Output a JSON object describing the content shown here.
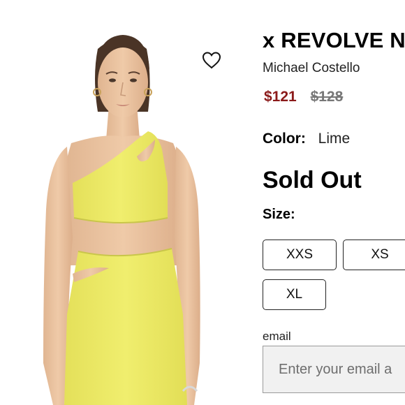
{
  "product": {
    "title": "x REVOLVE N",
    "brand": "Michael Costello",
    "price_sale": "$121",
    "price_original": "$128",
    "color_label": "Color:",
    "color_value": "Lime",
    "stock_status": "Sold Out",
    "size_label": "Size:",
    "sizes": [
      "XXS",
      "XS",
      "XL"
    ]
  },
  "notify": {
    "email_label": "email",
    "email_placeholder": "Enter your email a"
  },
  "colors": {
    "sale_price": "#8b1a1a",
    "garment_lime": "#ecea63",
    "border": "#222222",
    "input_background": "#f1f1f1"
  },
  "icons": {
    "wishlist": "heart-outline-icon"
  }
}
